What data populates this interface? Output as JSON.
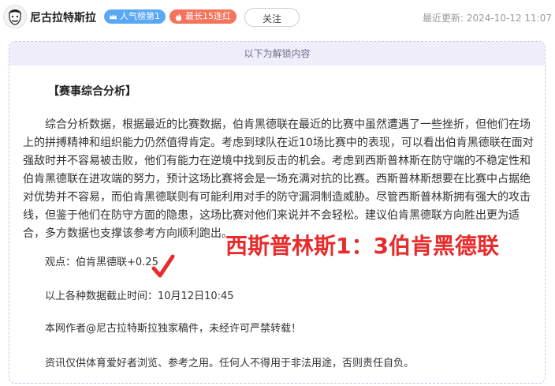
{
  "header": {
    "author": "尼古拉特斯拉",
    "badge_popularity": "人气榜第1",
    "badge_streak": "最长15连红",
    "follow_label": "关注",
    "update_label": "最近更新:",
    "update_time": "2024-10-12 11:07"
  },
  "panel": {
    "unlock_banner": "以下为解锁内容",
    "section_title": "【赛事综合分析】",
    "paragraph": "综合分析数据，根据最近的比赛数据，伯肯黑德联在最近的比赛中虽然遭遇了一些挫折，但他们在场上的拼搏精神和组织能力仍然值得肯定。考虑到球队在近10场比赛中的表现，可以看出伯肯黑德联在面对强敌时并不容易被击败，他们有能力在逆境中找到反击的机会。考虑到西斯普林斯在防守端的不稳定性和伯肯黑德联在进攻端的努力，预计这场比赛将会是一场充满对抗的比赛。西斯普林斯想要在比赛中占据绝对优势并不容易，而伯肯黑德联则有可能利用对手的防守漏洞制造威胁。尽管西斯普林斯拥有强大的攻击线，但鉴于他们在防守方面的隐患，这场比赛对他们来说并不会轻松。建议伯肯黑德联方向胜出更为适合，多方数据也支撑该参考方向顺利跑出。",
    "opinion": "观点：伯肯黑德联+0.25",
    "cutoff": "以上各种数据截止时间：10月12日10:45",
    "copyright": "本网作者@尼古拉特斯拉独家稿件，未经许可严禁转载！",
    "disclaimer": "资讯仅供体育爱好者浏览、参考之用。任何人不得用于非法用途，否则责任自负。"
  },
  "overlay": {
    "result": "西斯普林斯1：3伯肯黑德联",
    "color": "#e82b2b"
  },
  "colors": {
    "badge_popularity": "#5aa8f3",
    "badge_streak": "#f4735c",
    "unlock_bar": "#efeefa"
  }
}
